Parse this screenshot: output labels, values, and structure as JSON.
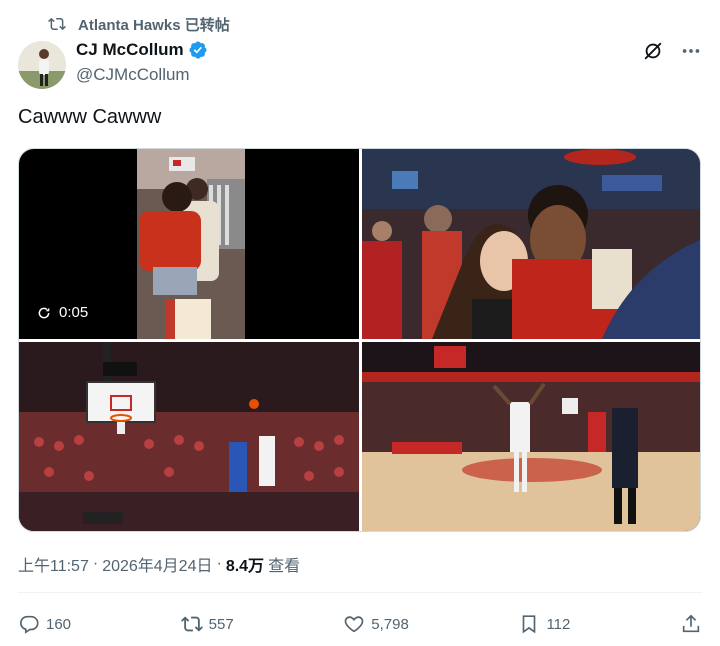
{
  "retweet": {
    "label": "Atlanta Hawks 已转帖"
  },
  "author": {
    "name": "CJ McCollum",
    "handle": "@CJMcCollum",
    "verified_color": "#1d9bf0"
  },
  "tweet": {
    "text": "Cawww Cawww"
  },
  "media": {
    "video_duration": "0:05"
  },
  "meta": {
    "time": "上午11:57",
    "sep1": "·",
    "date": "2026年4月24日",
    "sep2": "·",
    "views": "8.4万",
    "views_label": "查看"
  },
  "actions": {
    "replies": "160",
    "reposts": "557",
    "likes": "5,798",
    "bookmarks": "112"
  },
  "colors": {
    "text": "#0f1419",
    "muted": "#536471",
    "accent": "#1d9bf0"
  }
}
